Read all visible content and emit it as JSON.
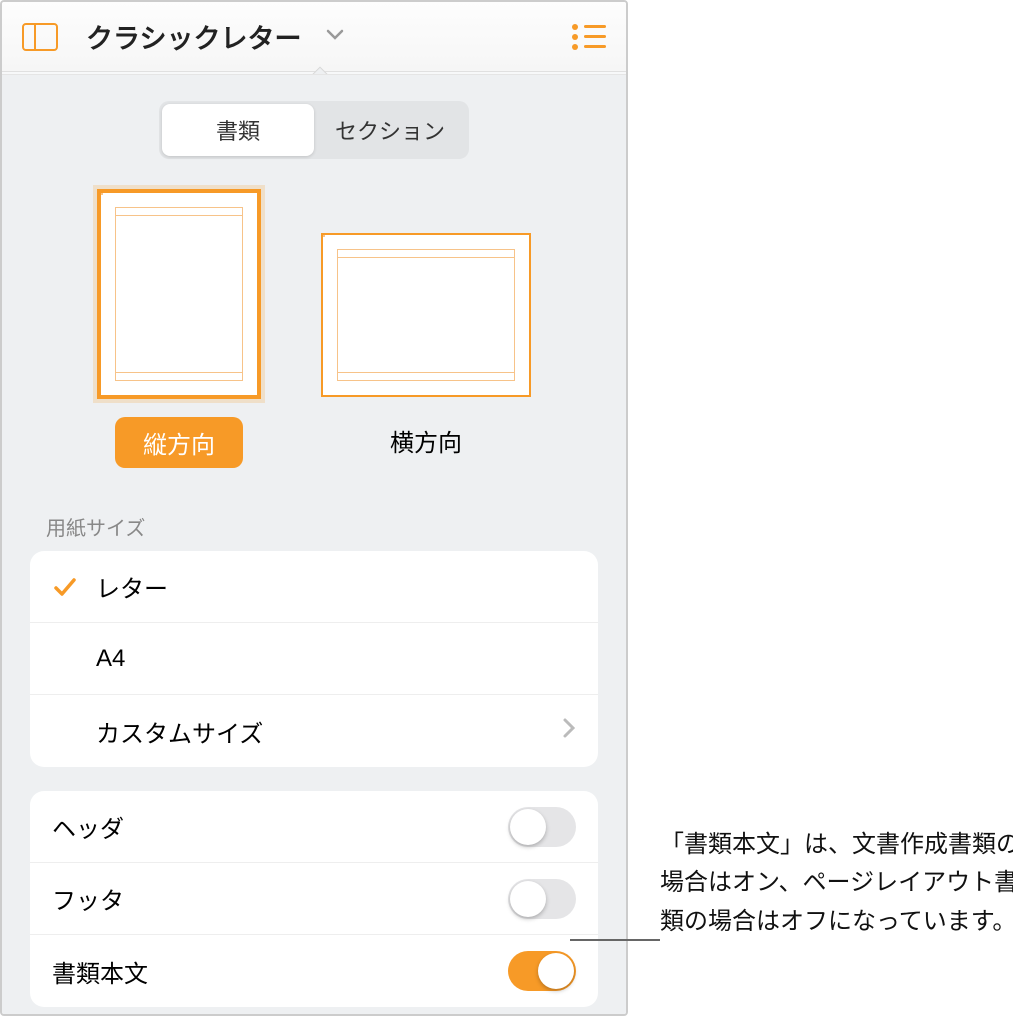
{
  "header": {
    "title": "クラシックレター"
  },
  "tabs": {
    "document": "書類",
    "section": "セクション"
  },
  "orientation": {
    "portrait": "縦方向",
    "landscape": "横方向"
  },
  "paper_size_header": "用紙サイズ",
  "paper_sizes": {
    "letter": "レター",
    "a4": "A4",
    "custom": "カスタムサイズ"
  },
  "toggles": {
    "header": "ヘッダ",
    "footer": "フッタ",
    "body": "書類本文"
  },
  "annotation": "「書類本文」は、文書作成書類の場合はオン、ページレイアウト書類の場合はオフになっています。"
}
